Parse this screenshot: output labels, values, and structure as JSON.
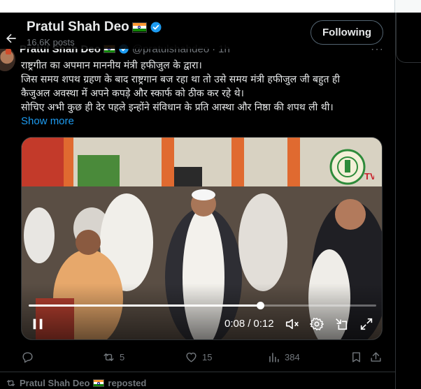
{
  "header": {
    "name": "Pratul Shah Deo",
    "posts": "16.6K posts",
    "follow_label": "Following"
  },
  "post": {
    "author_name": "Pratul Shah Deo",
    "handle": "@pratulshahdeo",
    "time": "1h",
    "lines": [
      "राष्ट्रगीत का अपमान माननीय मंत्री हफीजुल के द्वारा।",
      "जिस समय शपथ ग्रहण के बाद राष्ट्रगान बज रहा था तो उसे समय मंत्री हफीजुल जी बहुत ही",
      "कैजुअल अवस्था में अपने कपड़े और स्कार्फ को ठीक कर रहे थे।",
      "सोचिए अभी कुछ ही देर पहले इन्होंने संविधान के प्रति आस्था और निष्ठा की शपथ ली थी।"
    ],
    "show_more": "Show more"
  },
  "video": {
    "current_time": "0:08",
    "separator": "/",
    "duration": "0:12",
    "progress_fraction": 0.667,
    "controls": [
      "pause-icon",
      "mute-icon",
      "settings-icon",
      "minimize-icon",
      "fullscreen-icon"
    ],
    "logo_text": "TV"
  },
  "actions": {
    "replies": "",
    "reposts": "5",
    "likes": "15",
    "views": "384"
  },
  "next_post": {
    "reposted_by": "Pratul Shah Deo",
    "reposted_label": "reposted"
  },
  "colors": {
    "accent": "#1d9bf0",
    "muted": "#71767b",
    "text": "#e7e9ea",
    "border": "#2f3336"
  }
}
